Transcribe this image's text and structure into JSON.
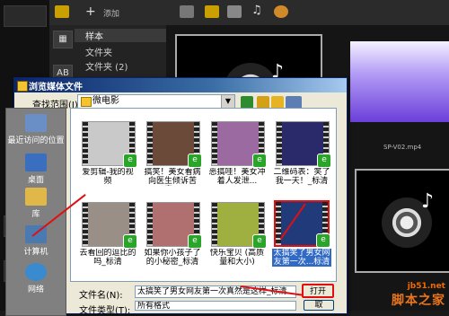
{
  "editor": {
    "toolbar": {
      "add_label": "添加"
    },
    "nav_items": [
      {
        "label": "样本",
        "selected": true
      },
      {
        "label": "文件夹"
      },
      {
        "label": "文件夹 (2)"
      }
    ],
    "nav_icon_letters": [
      "AB"
    ],
    "preview_caption": "SP-V02.mp4"
  },
  "dialog": {
    "title": "浏览媒体文件",
    "look_in_label": "查找范围(I):",
    "look_in_value": "微电影",
    "places": [
      {
        "label": "最近访问的位置",
        "icon": "recent-icon"
      },
      {
        "label": "桌面",
        "icon": "desktop-icon"
      },
      {
        "label": "库",
        "icon": "library-icon"
      },
      {
        "label": "计算机",
        "icon": "computer-icon"
      },
      {
        "label": "网络",
        "icon": "network-icon"
      }
    ],
    "files": [
      {
        "caption": "爱剪辑-我的视频",
        "color": "#c9c9c9"
      },
      {
        "caption": "搞笑！美女看病向医生倾诉苦衷...",
        "color": "#6b4a3a"
      },
      {
        "caption": "恶搞哇！美女冲着人发泄...",
        "color": "#9a6aa0"
      },
      {
        "caption": "二维码表：笑了我一天！_标清",
        "color": "#2a2a6a"
      },
      {
        "caption": "去看回的逗比的吗_标清",
        "color": "#9a8f86"
      },
      {
        "caption": "如果你小孩子了的小秘密_标清",
        "color": "#b07070"
      },
      {
        "caption": "快乐宝贝 (高质量和大小)",
        "color": "#a0b040"
      },
      {
        "caption": "太搞笑了男女网友第一次...标清",
        "color": "#203a7a",
        "selected": true
      }
    ],
    "filename_label": "文件名(N):",
    "filename_value": "太搞笑了男女网友第一次真然是这样_标清",
    "filetype_label": "文件类型(T):",
    "filetype_value": "所有格式",
    "open_button": "打开",
    "cancel_button": "取"
  },
  "watermark": {
    "url": "jb51.net",
    "name": "脚本之家"
  }
}
